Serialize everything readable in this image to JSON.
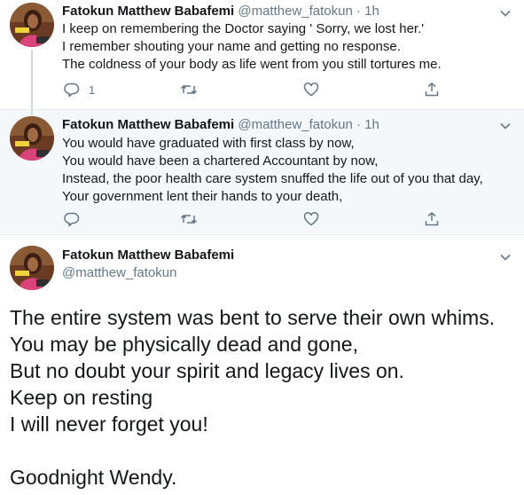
{
  "tweets": [
    {
      "name": "Fatokun Matthew Babafemi",
      "handle": "@matthew_fatokun",
      "dot": "·",
      "time": "1h",
      "lines": [
        "I keep on remembering the Doctor saying ' Sorry, we lost her.'",
        "I remember shouting your name and getting no response.",
        "The coldness of your body as life went from you still tortures me."
      ],
      "reply_count": "1"
    },
    {
      "name": "Fatokun Matthew Babafemi",
      "handle": "@matthew_fatokun",
      "dot": "·",
      "time": "1h",
      "lines": [
        "You would have graduated with first class by now,",
        "You would have been a chartered Accountant by now,",
        "Instead, the poor health care system snuffed the life out of you that day,",
        "Your government lent their hands to your death,"
      ],
      "reply_count": ""
    }
  ],
  "main_tweet": {
    "name": "Fatokun Matthew Babafemi",
    "handle": "@matthew_fatokun",
    "lines": [
      "The entire system was bent to serve their own whims.",
      "You may be physically dead and gone,",
      "But no doubt your spirit and legacy lives on.",
      "Keep on resting",
      "I will never forget you!",
      "",
      "Goodnight Wendy."
    ]
  },
  "colors": {
    "text": "#14171a",
    "secondary": "#657786",
    "thread_line": "#ccd6dd",
    "highlight_bg": "#f5f8fa"
  },
  "icons": [
    "reply-icon",
    "retweet-icon",
    "like-icon",
    "share-icon",
    "chevron-down-icon"
  ]
}
